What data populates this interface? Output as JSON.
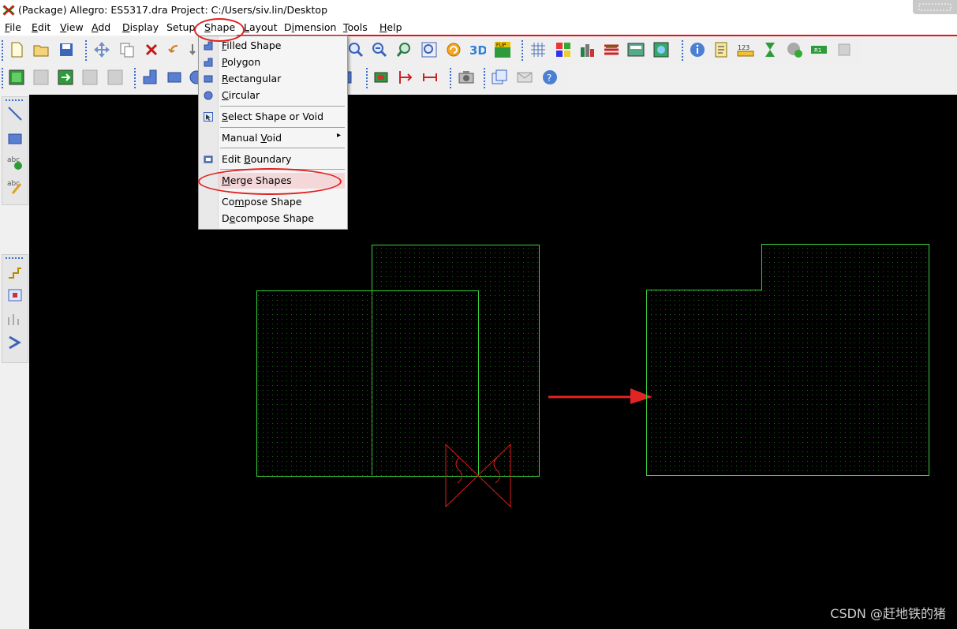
{
  "window": {
    "title": "(Package) Allegro: ES5317.dra  Project: C:/Users/siv.lin/Desktop"
  },
  "menubar": {
    "items": [
      {
        "label": "File",
        "key": "F",
        "rest": "ile"
      },
      {
        "label": "Edit",
        "key": "E",
        "rest": "dit"
      },
      {
        "label": "View",
        "key": "V",
        "rest": "iew"
      },
      {
        "label": "Add",
        "key": "A",
        "rest": "dd"
      },
      {
        "label": "Display",
        "key": "D",
        "rest": "isplay"
      },
      {
        "label": "Setup",
        "key": "",
        "rest": "Setup"
      },
      {
        "label": "Shape",
        "key": "S",
        "rest": "hape"
      },
      {
        "label": "Layout",
        "key": "L",
        "rest": "ayout"
      },
      {
        "label": "Dimension",
        "key": "i",
        "pre": "D",
        "rest": "mension"
      },
      {
        "label": "Tools",
        "key": "T",
        "rest": "ools"
      },
      {
        "label": "Help",
        "key": "H",
        "rest": "elp"
      }
    ]
  },
  "shape_menu": {
    "items": [
      {
        "label": "Filled Shape",
        "icon": "filled-shape-icon"
      },
      {
        "label": "Polygon",
        "icon": "polygon-icon"
      },
      {
        "label": "Rectangular",
        "icon": "rectangle-icon"
      },
      {
        "label": "Circular",
        "icon": "circle-icon"
      },
      {
        "label": "Select Shape or Void",
        "icon": "select-shape-icon"
      },
      {
        "label": "Manual Void",
        "icon": "",
        "submenu": true
      },
      {
        "label": "Edit Boundary",
        "icon": "edit-boundary-icon"
      },
      {
        "label": "Merge Shapes",
        "icon": "",
        "highlighted": true
      },
      {
        "label": "Compose Shape",
        "icon": ""
      },
      {
        "label": "Decompose Shape",
        "icon": ""
      }
    ],
    "submenu_arrow": "▸"
  },
  "toolbar1": {
    "buttons": [
      "new-icon",
      "open-icon",
      "save-icon",
      "move-icon",
      "copy-icon",
      "delete-icon",
      "undo-icon",
      "redo-icon",
      "zoom-in-icon",
      "zoom-out-icon",
      "zoom-previous-icon",
      "zoom-fit-icon",
      "refresh-icon",
      "3d-view-icon",
      "flip-icon",
      "grid-icon",
      "color-icon",
      "layer-icon",
      "shadow-icon",
      "dcm-icon",
      "world-view-icon",
      "info-icon",
      "report-icon",
      "measure-icon",
      "hourglass-icon",
      "status-icon",
      "r1-icon",
      "disabled-icon"
    ],
    "labels": {
      "threed": "3D",
      "flip": "FLIP",
      "measure": "123",
      "r1": "R1"
    }
  },
  "toolbar2": {
    "buttons": [
      "pin-icon",
      "via-icon",
      "component-icon",
      "cline-icon",
      "shape-icon",
      "l-shape-icon",
      "rect-icon",
      "circle-icon",
      "rect2-icon",
      "module-icon",
      "dimension-icon",
      "distance-icon",
      "camera-icon",
      "copy-window-icon",
      "mail-icon",
      "help-icon"
    ]
  },
  "leftbar": {
    "buttons": [
      "line-icon",
      "rectangle-tool-icon",
      "add-text-icon",
      "edit-text-icon",
      "route-icon",
      "place-icon",
      "fanout-icon",
      "slide-icon"
    ],
    "abc": "abc"
  },
  "canvas": {
    "background": "#000000",
    "shape_color": "#38d238",
    "marker_color": "#e11b1b",
    "arrow_color": "#e02525"
  },
  "watermark": "CSDN @赶地铁的猪"
}
